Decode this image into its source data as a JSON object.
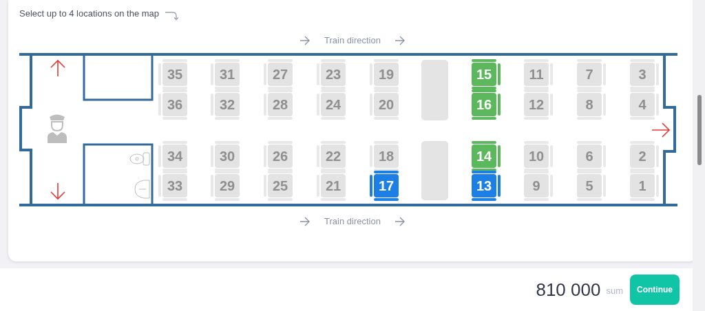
{
  "instruction": "Select up to 4 locations on the map",
  "direction_labels": [
    "Train direction",
    "Train direction"
  ],
  "seat_rows": [
    {
      "left": [
        {
          "number": "35",
          "taken": true,
          "selected": false
        },
        {
          "number": "31",
          "taken": true,
          "selected": false
        },
        {
          "number": "27",
          "taken": true,
          "selected": false
        },
        {
          "number": "23",
          "taken": true,
          "selected": false
        },
        {
          "number": "19",
          "taken": true,
          "selected": false
        }
      ],
      "right": [
        {
          "number": "15",
          "taken": false,
          "selected": false
        },
        {
          "number": "11",
          "taken": true,
          "selected": false
        },
        {
          "number": "7",
          "taken": true,
          "selected": false
        },
        {
          "number": "3",
          "taken": true,
          "selected": false
        }
      ]
    },
    {
      "left": [
        {
          "number": "36",
          "taken": true,
          "selected": false
        },
        {
          "number": "32",
          "taken": true,
          "selected": false
        },
        {
          "number": "28",
          "taken": true,
          "selected": false
        },
        {
          "number": "24",
          "taken": true,
          "selected": false
        },
        {
          "number": "20",
          "taken": true,
          "selected": false
        }
      ],
      "right": [
        {
          "number": "16",
          "taken": false,
          "selected": false
        },
        {
          "number": "12",
          "taken": true,
          "selected": false
        },
        {
          "number": "8",
          "taken": true,
          "selected": false
        },
        {
          "number": "4",
          "taken": true,
          "selected": false
        }
      ]
    },
    {
      "left": [
        {
          "number": "34",
          "taken": true,
          "selected": false
        },
        {
          "number": "30",
          "taken": true,
          "selected": false
        },
        {
          "number": "26",
          "taken": true,
          "selected": false
        },
        {
          "number": "22",
          "taken": true,
          "selected": false
        },
        {
          "number": "18",
          "taken": true,
          "selected": false
        }
      ],
      "right": [
        {
          "number": "14",
          "taken": false,
          "selected": false
        },
        {
          "number": "10",
          "taken": true,
          "selected": false
        },
        {
          "number": "6",
          "taken": true,
          "selected": false
        },
        {
          "number": "2",
          "taken": true,
          "selected": false
        }
      ]
    },
    {
      "left": [
        {
          "number": "33",
          "taken": true,
          "selected": false
        },
        {
          "number": "29",
          "taken": true,
          "selected": false
        },
        {
          "number": "25",
          "taken": true,
          "selected": false
        },
        {
          "number": "21",
          "taken": true,
          "selected": false
        },
        {
          "number": "17",
          "taken": false,
          "selected": true
        }
      ],
      "right": [
        {
          "number": "13",
          "taken": false,
          "selected": true
        },
        {
          "number": "9",
          "taken": true,
          "selected": false
        },
        {
          "number": "5",
          "taken": true,
          "selected": false
        },
        {
          "number": "1",
          "taken": true,
          "selected": false
        }
      ]
    }
  ],
  "total": {
    "amount": "810 000",
    "currency": "sum"
  },
  "continue_button": "Continue"
}
